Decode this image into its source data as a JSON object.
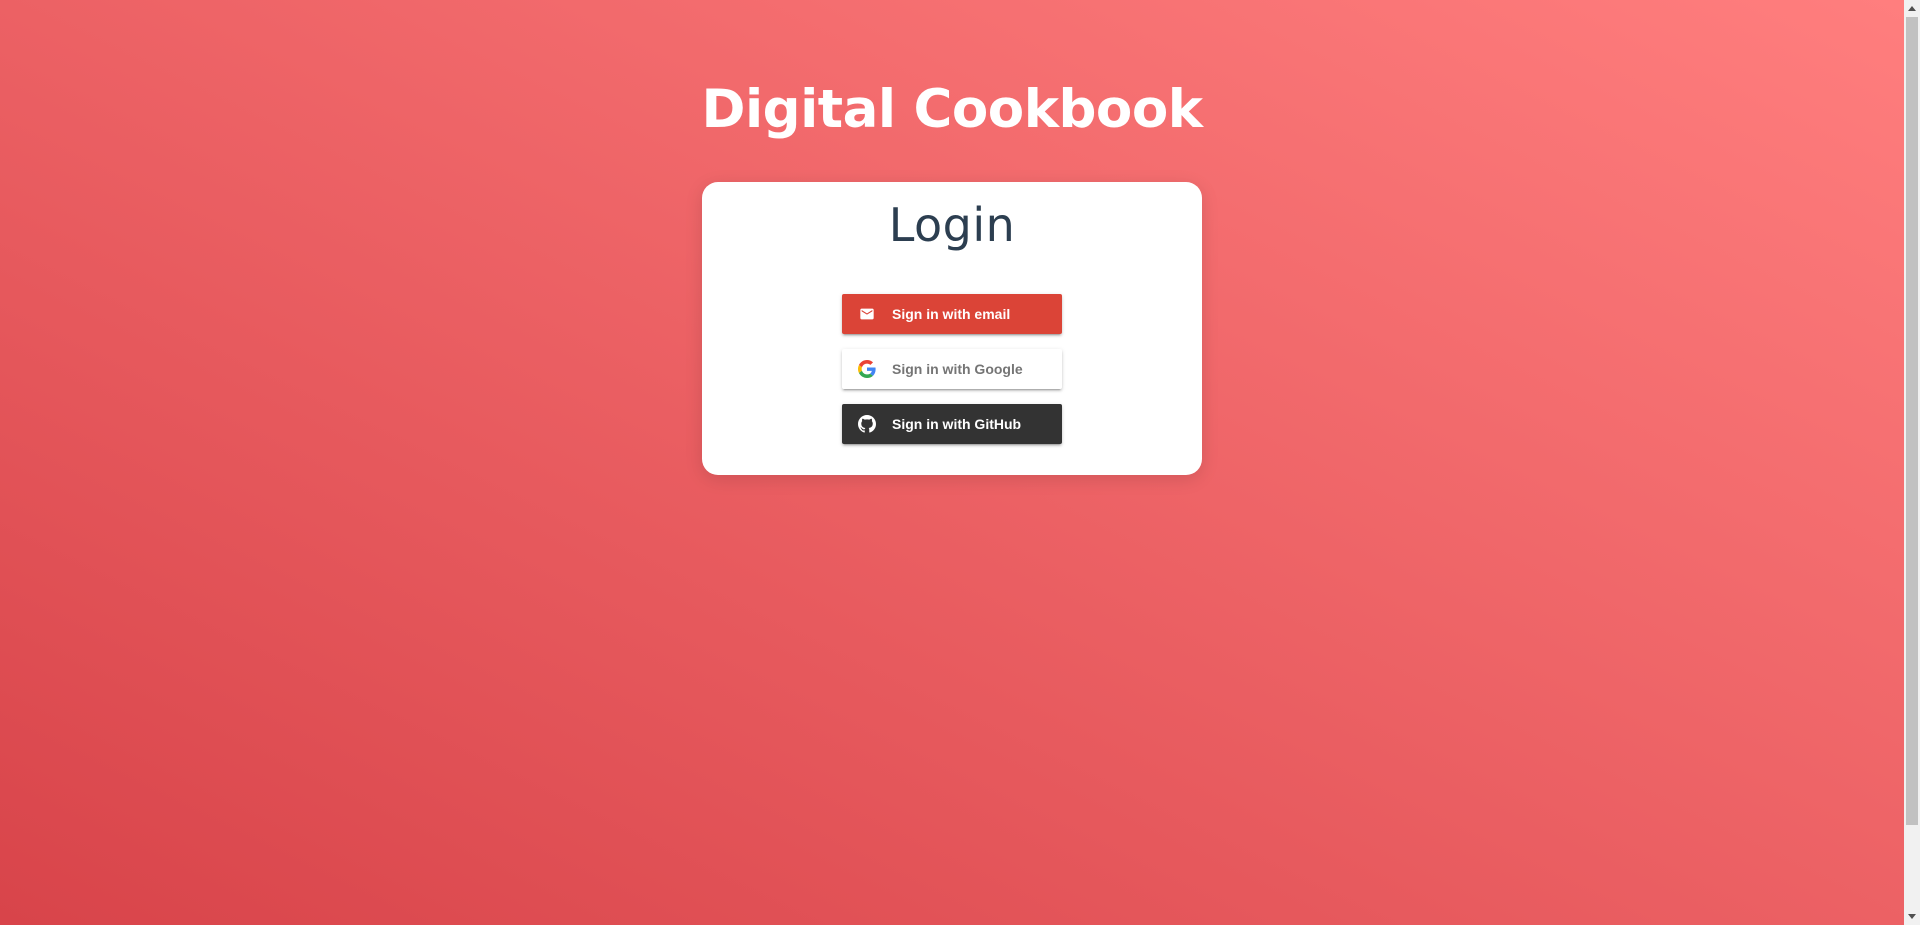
{
  "app": {
    "title": "Digital Cookbook"
  },
  "login_card": {
    "title": "Login",
    "providers": [
      {
        "label": "Sign in with email",
        "icon": "mail-icon",
        "background": "#db4437",
        "text_color": "#ffffff"
      },
      {
        "label": "Sign in with Google",
        "icon": "google-icon",
        "background": "#ffffff",
        "text_color": "#757575"
      },
      {
        "label": "Sign in with GitHub",
        "icon": "github-icon",
        "background": "#333333",
        "text_color": "#ffffff"
      }
    ]
  },
  "colors": {
    "background_gradient_start": "#d8444a",
    "background_gradient_end": "#ff7e7e",
    "card_title": "#2c3e50"
  }
}
